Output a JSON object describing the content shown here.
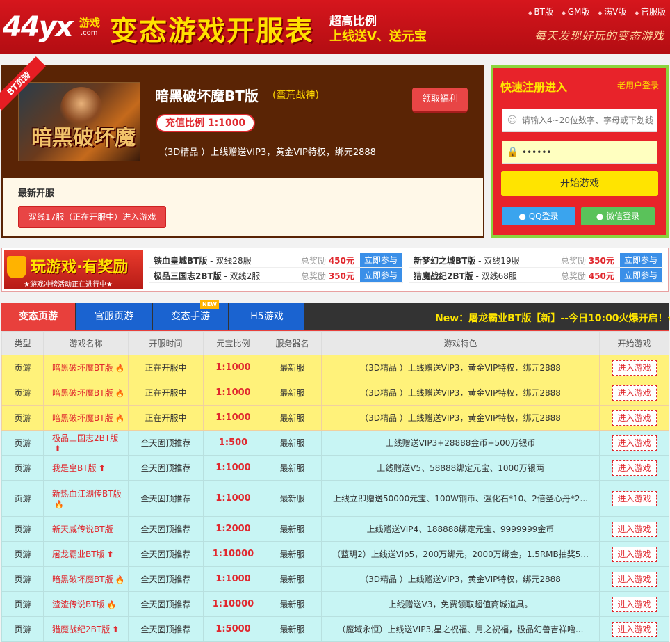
{
  "header": {
    "logo_main": "44yx",
    "logo_sub": "游戏",
    "logo_com": ".com",
    "title": "变态游戏开服表",
    "slogan_line1": "超高比例",
    "slogan_line2": "上线送V、送元宝",
    "nav": [
      "BT版",
      "GM版",
      "满V版",
      "官服版"
    ],
    "motto": "每天发现好玩的变态游戏"
  },
  "featured": {
    "ribbon": "BT页游",
    "image_text": "暗黑破坏魔",
    "title": "暗黑破坏魔BT版",
    "subtitle": "(蛮荒战神)",
    "ratio": "充值比例 1:1000",
    "description": "（3D精品 ）上线赠送VIP3，黄金VIP特权，绑元2888",
    "welfare_button": "领取福利",
    "latest_label": "最新开服",
    "server_button": "双线17服（正在开服中）进入游戏"
  },
  "register": {
    "title": "快速注册进入",
    "old_user": "老用户登录",
    "username_placeholder": "请输入4~20位数字、字母或下划线",
    "password_value": "••••••",
    "start_button": "开始游戏",
    "qq_button": "QQ登录",
    "wechat_button": "微信登录"
  },
  "promo": {
    "banner_main": "玩游戏·有奖励",
    "banner_sub": "★游戏冲榜活动正在进行中★",
    "items": [
      {
        "game": "铁血皇城BT版",
        "server": " - 双线28服",
        "reward_label": "总奖励 ",
        "reward": "450元",
        "button": "立即参与"
      },
      {
        "game": "极品三国志2BT版",
        "server": " - 双线2服",
        "reward_label": "总奖励 ",
        "reward": "350元",
        "button": "立即参与"
      },
      {
        "game": "新梦幻之城BT版",
        "server": " - 双线19服",
        "reward_label": "总奖励 ",
        "reward": "350元",
        "button": "立即参与"
      },
      {
        "game": "猎魔战纪2BT版",
        "server": " - 双线68服",
        "reward_label": "总奖励 ",
        "reward": "450元",
        "button": "立即参与"
      }
    ]
  },
  "tabs": {
    "items": [
      "变态页游",
      "官服页游",
      "变态手游",
      "H5游戏"
    ],
    "new_badge": "NEW",
    "marquee": "New：屠龙霸业BT版【新】--今日10:00火爆开启！√"
  },
  "table": {
    "headers": [
      "类型",
      "游戏名称",
      "开服时间",
      "元宝比例",
      "服务器名",
      "游戏特色",
      "开始游戏"
    ],
    "rows": [
      {
        "type": "页游",
        "name": "暗黑破坏魔BT版",
        "mark": "fire",
        "time": "正在开服中",
        "ratio": "1:1000",
        "server": "最新服",
        "feature": "（3D精品 ）上线赠送VIP3，黄金VIP特权，绑元2888",
        "enter": "进入游戏",
        "style": "hot"
      },
      {
        "type": "页游",
        "name": "暗黑破坏魔BT版",
        "mark": "fire",
        "time": "正在开服中",
        "ratio": "1:1000",
        "server": "最新服",
        "feature": "（3D精品 ）上线赠送VIP3，黄金VIP特权，绑元2888",
        "enter": "进入游戏",
        "style": "hot"
      },
      {
        "type": "页游",
        "name": "暗黑破坏魔BT版",
        "mark": "fire",
        "time": "正在开服中",
        "ratio": "1:1000",
        "server": "最新服",
        "feature": "（3D精品 ）上线赠送VIP3，黄金VIP特权，绑元2888",
        "enter": "进入游戏",
        "style": "hot"
      },
      {
        "type": "页游",
        "name": "极品三国志2BT版",
        "mark": "up",
        "time": "全天固顶推荐",
        "ratio": "1:500",
        "server": "最新服",
        "feature": "上线赠送VIP3+28888金币+500万银币",
        "enter": "进入游戏",
        "style": "rec"
      },
      {
        "type": "页游",
        "name": "我是皇BT版",
        "mark": "up",
        "time": "全天固顶推荐",
        "ratio": "1:1000",
        "server": "最新服",
        "feature": "上线赠送V5、58888绑定元宝、1000万银两",
        "enter": "进入游戏",
        "style": "rec"
      },
      {
        "type": "页游",
        "name": "新热血江湖传BT版",
        "mark": "fire",
        "time": "全天固顶推荐",
        "ratio": "1:1000",
        "server": "最新服",
        "feature": "上线立即赠送50000元宝、100W铜币、强化石*10、2倍圣心丹*2...",
        "enter": "进入游戏",
        "style": "rec tall"
      },
      {
        "type": "页游",
        "name": "新天威传说BT版",
        "mark": "",
        "time": "全天固顶推荐",
        "ratio": "1:2000",
        "server": "最新服",
        "feature": "上线赠送VIP4、188888绑定元宝、9999999金币",
        "enter": "进入游戏",
        "style": "rec"
      },
      {
        "type": "页游",
        "name": "屠龙霸业BT版",
        "mark": "up",
        "time": "全天固顶推荐",
        "ratio": "1:10000",
        "server": "最新服",
        "feature": "（蓝玥2）上线送Vip5，200万绑元，2000万绑金，1.5RMB抽奖5...",
        "enter": "进入游戏",
        "style": "rec"
      },
      {
        "type": "页游",
        "name": "暗黑破坏魔BT版",
        "mark": "fire",
        "time": "全天固顶推荐",
        "ratio": "1:1000",
        "server": "最新服",
        "feature": "（3D精品 ）上线赠送VIP3，黄金VIP特权，绑元2888",
        "enter": "进入游戏",
        "style": "rec"
      },
      {
        "type": "页游",
        "name": "渣渣传说BT版",
        "mark": "fire",
        "time": "全天固顶推荐",
        "ratio": "1:10000",
        "server": "最新服",
        "feature": "上线赠送V3，免费领取超值商城道具。",
        "enter": "进入游戏",
        "style": "rec"
      },
      {
        "type": "页游",
        "name": "猎魔战纪2BT版",
        "mark": "up",
        "time": "全天固顶推荐",
        "ratio": "1:5000",
        "server": "最新服",
        "feature": "（魔域永恒）上线送VIP3,星之祝福、月之祝福，极品幻兽吉祥噜...",
        "enter": "进入游戏",
        "style": "rec"
      }
    ]
  },
  "colors": {
    "brand_red": "#d6161d",
    "accent_yellow": "#ffe100",
    "tab_blue": "#1a63d0",
    "hot_row": "#fff27a",
    "rec_row": "#c8f5f4"
  }
}
